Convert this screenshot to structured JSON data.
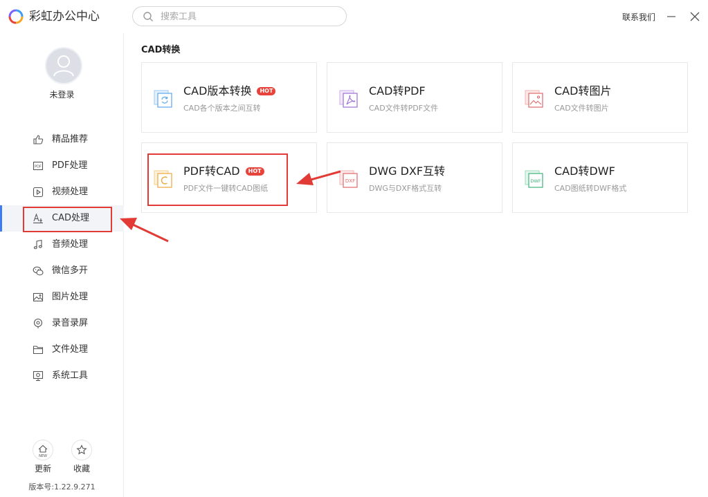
{
  "app": {
    "title": "彩虹办公中心"
  },
  "search": {
    "placeholder": "搜索工具"
  },
  "header": {
    "contact": "联系我们"
  },
  "user": {
    "status": "未登录"
  },
  "sidebar": {
    "items": [
      {
        "label": "精品推荐",
        "icon": "thumbs-up-icon"
      },
      {
        "label": "PDF处理",
        "icon": "pdf-icon"
      },
      {
        "label": "视频处理",
        "icon": "play-icon"
      },
      {
        "label": "CAD处理",
        "icon": "cad-icon",
        "active": true
      },
      {
        "label": "音频处理",
        "icon": "music-note-icon"
      },
      {
        "label": "微信多开",
        "icon": "wechat-icon"
      },
      {
        "label": "图片处理",
        "icon": "image-icon"
      },
      {
        "label": "录音录屏",
        "icon": "record-icon"
      },
      {
        "label": "文件处理",
        "icon": "folder-icon"
      },
      {
        "label": "系统工具",
        "icon": "monitor-icon"
      }
    ],
    "update_label": "更新",
    "update_badge": "NEW",
    "favorite_label": "收藏",
    "version": "版本号:1.22.9.271"
  },
  "main": {
    "section_title": "CAD转换",
    "cards": [
      {
        "title": "CAD版本转换",
        "desc": "CAD各个版本之间互转",
        "hot": "HOT",
        "icon": "cad-version-convert-icon"
      },
      {
        "title": "CAD转PDF",
        "desc": "CAD文件转PDF文件",
        "icon": "cad-to-pdf-icon"
      },
      {
        "title": "CAD转图片",
        "desc": "CAD文件转图片",
        "icon": "cad-to-image-icon"
      },
      {
        "title": "PDF转CAD",
        "desc": "PDF文件一键转CAD图纸",
        "hot": "HOT",
        "icon": "pdf-to-cad-icon"
      },
      {
        "title": "DWG DXF互转",
        "desc": "DWG与DXF格式互转",
        "icon": "dwg-dxf-icon",
        "icon_text": "DXF"
      },
      {
        "title": "CAD转DWF",
        "desc": "CAD图纸转DWF格式",
        "icon": "cad-to-dwf-icon",
        "icon_text": "DWF"
      }
    ]
  },
  "colors": {
    "accent": "#3d7cf2",
    "highlight": "#e23b35",
    "hot": "#e8433b"
  }
}
